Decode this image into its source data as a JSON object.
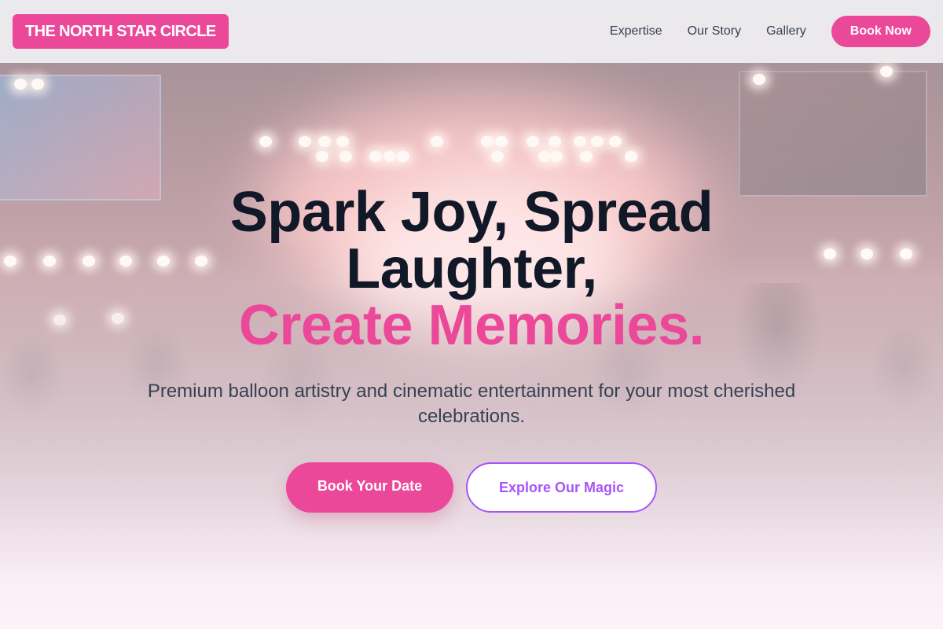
{
  "header": {
    "logo": "THE NORTH STAR CIRCLE",
    "nav": [
      "Expertise",
      "Our Story",
      "Gallery"
    ],
    "cta": "Book Now"
  },
  "hero": {
    "headline_line1": "Spark Joy, Spread",
    "headline_line2": "Laughter,",
    "headline_accent": "Create Memories.",
    "subtitle": "Premium balloon artistry and cinematic entertainment for your most cherished celebrations.",
    "primary_button": "Book Your Date",
    "secondary_button": "Explore Our Magic",
    "background_image": "concert-crowd-stage-lights"
  },
  "colors": {
    "brand_pink": "#ec4899",
    "accent_purple": "#a855f7",
    "heading": "#111827",
    "body_text": "#374151"
  }
}
